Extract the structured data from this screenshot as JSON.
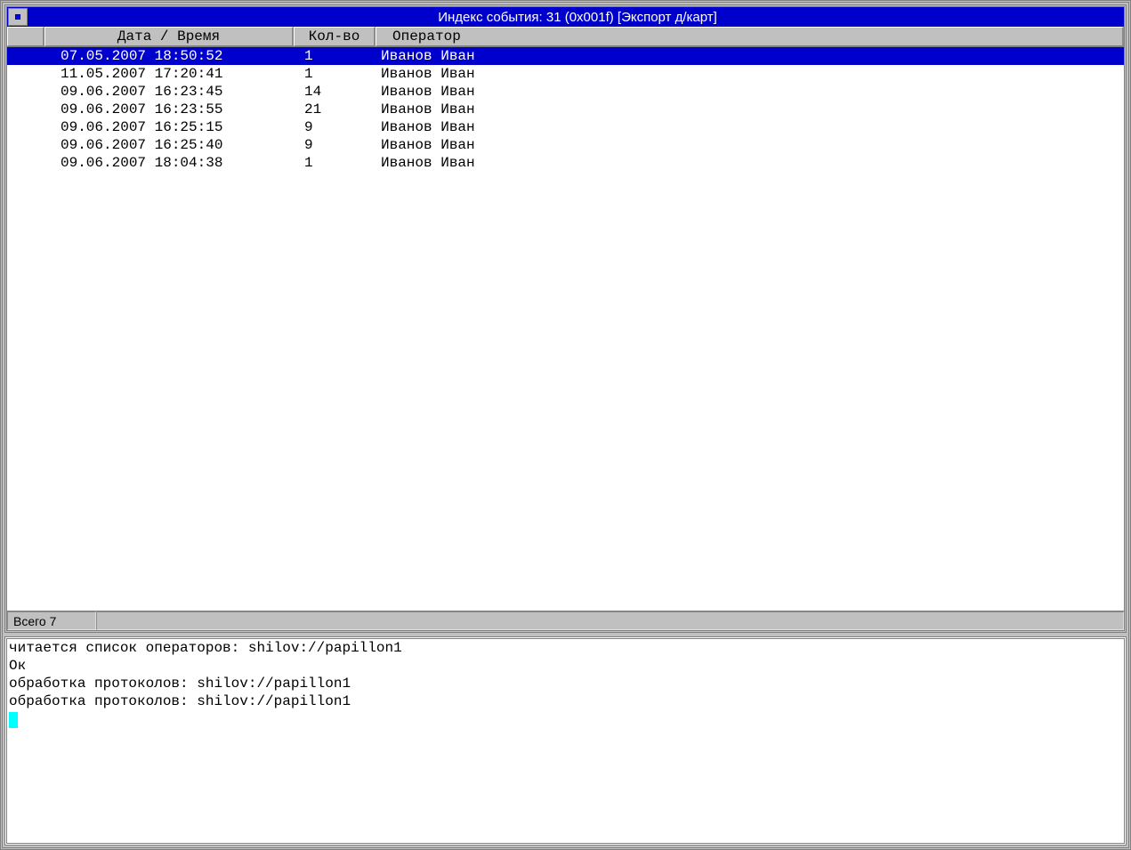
{
  "titlebar": {
    "text": "Индекс события: 31 (0x001f) [Экспорт д/карт]"
  },
  "columns": {
    "date": "Дата / Время",
    "count": "Кол-во",
    "operator": "Оператор"
  },
  "rows": [
    {
      "date": "07.05.2007 18:50:52",
      "count": "1",
      "operator": "Иванов Иван",
      "selected": true
    },
    {
      "date": "11.05.2007 17:20:41",
      "count": "1",
      "operator": "Иванов Иван",
      "selected": false
    },
    {
      "date": "09.06.2007 16:23:45",
      "count": "14",
      "operator": "Иванов Иван",
      "selected": false
    },
    {
      "date": "09.06.2007 16:23:55",
      "count": "21",
      "operator": "Иванов Иван",
      "selected": false
    },
    {
      "date": "09.06.2007 16:25:15",
      "count": "9",
      "operator": "Иванов Иван",
      "selected": false
    },
    {
      "date": "09.06.2007 16:25:40",
      "count": "9",
      "operator": "Иванов Иван",
      "selected": false
    },
    {
      "date": "09.06.2007 18:04:38",
      "count": "1",
      "operator": "Иванов Иван",
      "selected": false
    }
  ],
  "status": {
    "total": "Всего 7"
  },
  "log": [
    "читается список операторов: shilov://papillon1",
    "Ок",
    "обработка протоколов: shilov://papillon1",
    "обработка протоколов: shilov://papillon1"
  ]
}
